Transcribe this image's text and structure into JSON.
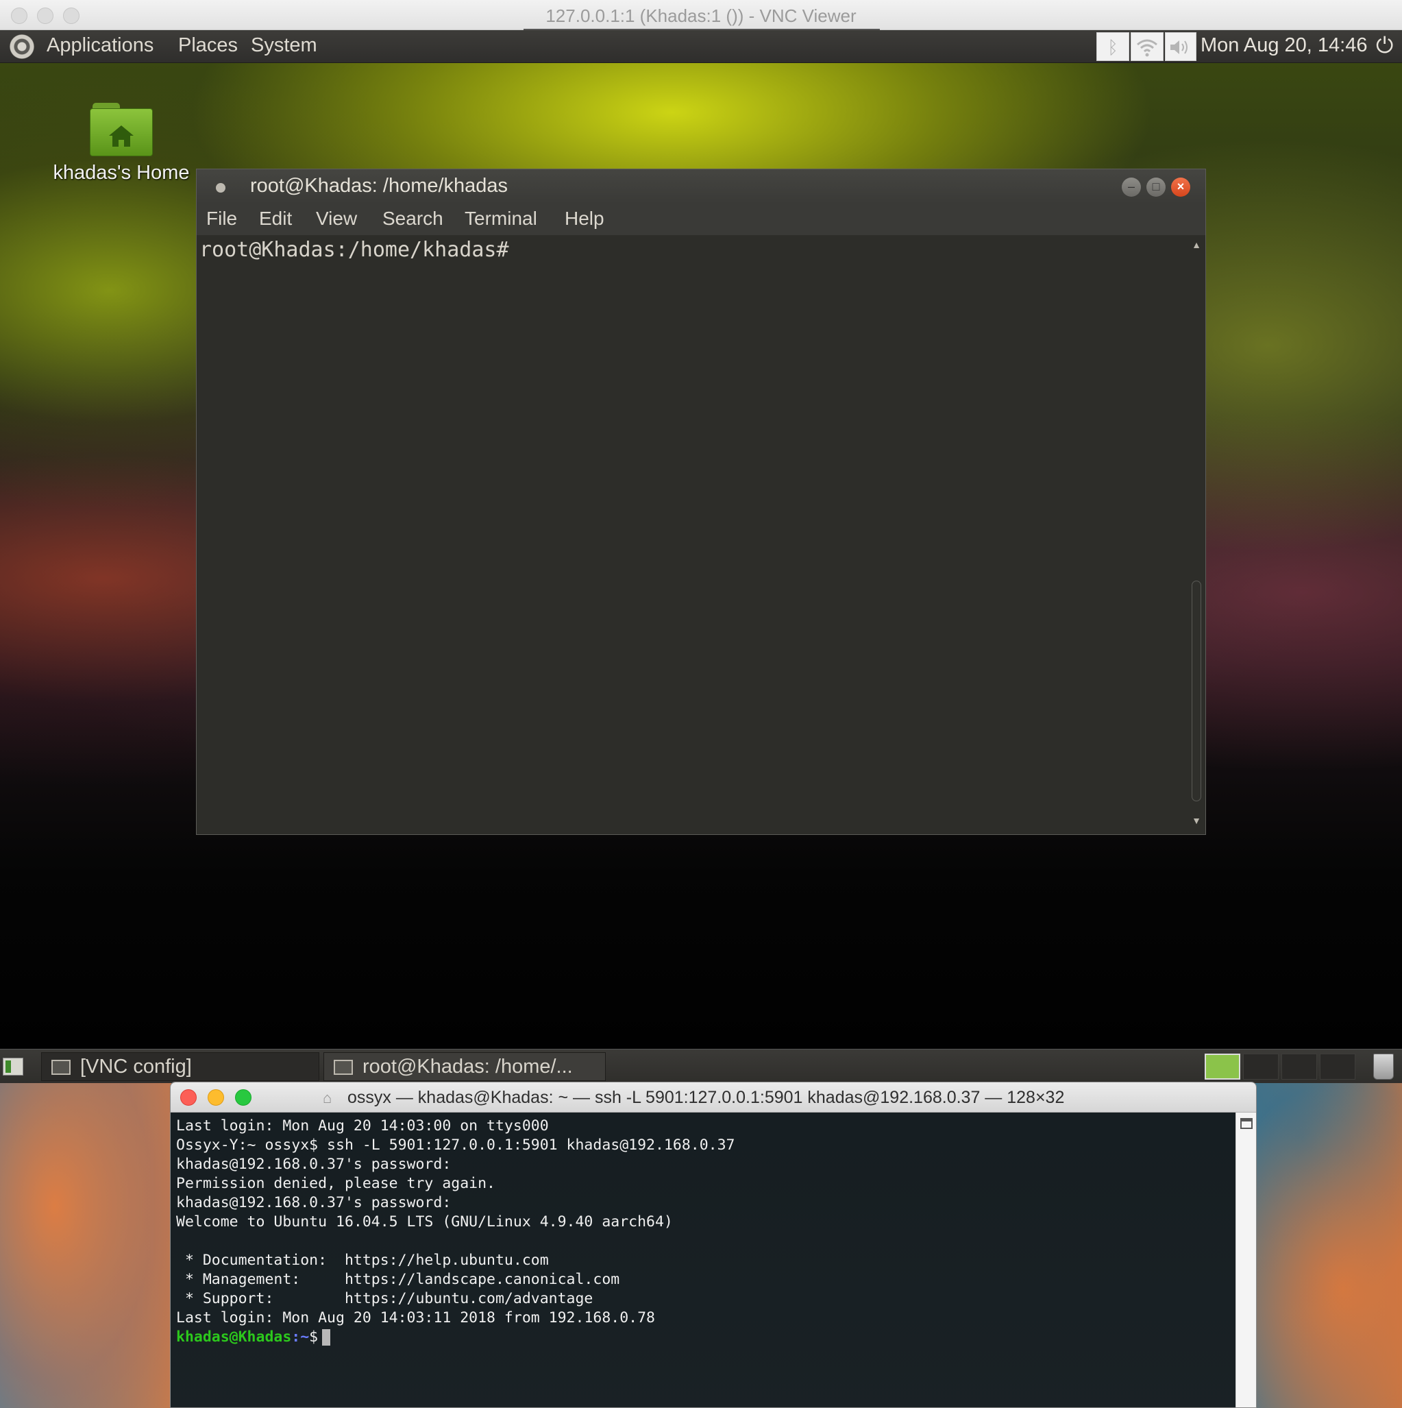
{
  "vnc_window": {
    "title": "127.0.0.1:1 (Khadas:1 ()) - VNC Viewer"
  },
  "top_panel": {
    "menus": [
      "Applications",
      "Places",
      "System"
    ],
    "tray_icons": [
      "bluetooth-icon",
      "wifi-icon",
      "volume-icon"
    ],
    "clock": "Mon Aug 20, 14:46"
  },
  "desktop": {
    "home_icon_label": "khadas's Home"
  },
  "mate_terminal": {
    "title": "root@Khadas: /home/khadas",
    "menu": [
      "File",
      "Edit",
      "View",
      "Search",
      "Terminal",
      "Help"
    ],
    "prompt": "root@Khadas:/home/khadas#"
  },
  "bottom_panel": {
    "tasks": [
      "[VNC config]",
      "root@Khadas: /home/..."
    ],
    "workspaces": 4
  },
  "mac_terminal": {
    "title": "ossyx — khadas@Khadas: ~ — ssh -L 5901:127.0.0.1:5901 khadas@192.168.0.37 — 128×32",
    "lines": [
      "Last login: Mon Aug 20 14:03:00 on ttys000",
      "Ossyx-Y:~ ossyx$ ssh -L 5901:127.0.0.1:5901 khadas@192.168.0.37",
      "khadas@192.168.0.37's password:",
      "Permission denied, please try again.",
      "khadas@192.168.0.37's password:",
      "Welcome to Ubuntu 16.04.5 LTS (GNU/Linux 4.9.40 aarch64)",
      "",
      " * Documentation:  https://help.ubuntu.com",
      " * Management:     https://landscape.canonical.com",
      " * Support:        https://ubuntu.com/advantage",
      "Last login: Mon Aug 20 14:03:11 2018 from 192.168.0.78"
    ],
    "prompt_user": "khadas@Khadas",
    "prompt_path": ":~",
    "prompt_symbol": "$"
  },
  "colors": {
    "prompt_green": "#2cc81c",
    "prompt_blue": "#6a7cff",
    "mac_close": "#fc5f57",
    "mac_minimize": "#fdbc2e",
    "mac_zoom": "#28c840",
    "mate_close": "#e2542a"
  }
}
